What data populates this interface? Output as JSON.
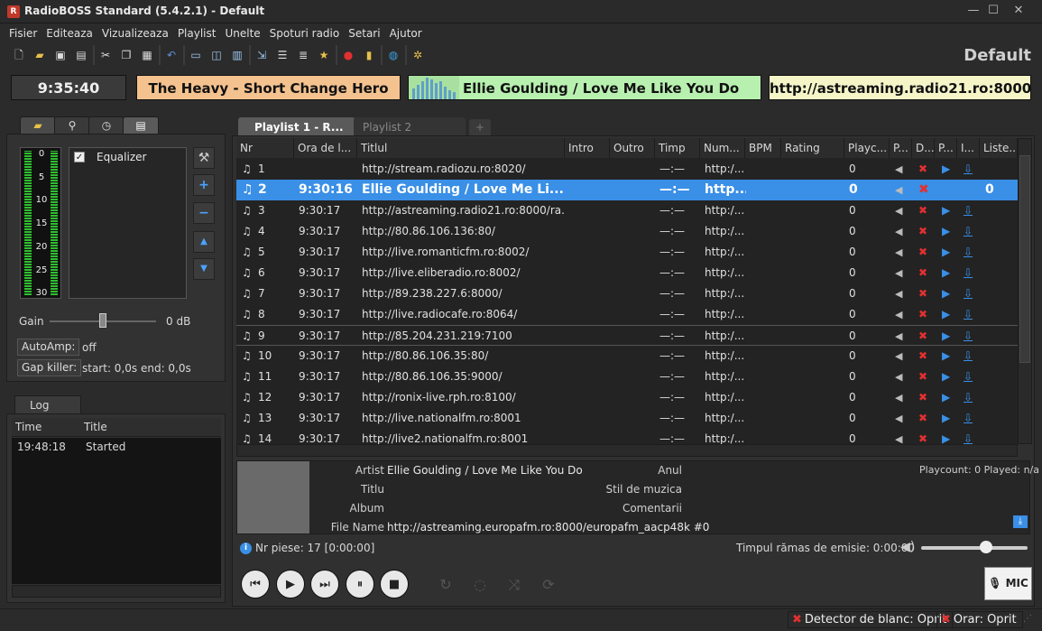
{
  "window": {
    "title": "RadioBOSS Standard (5.4.2.1) - Default",
    "min_label": "—",
    "max_label": "☐",
    "close_label": "✕"
  },
  "menu": [
    "Fisier",
    "Editeaza",
    "Vizualizeaza",
    "Playlist",
    "Unelte",
    "Spoturi radio",
    "Setari",
    "Ajutor"
  ],
  "profile_name": "Default",
  "infobar": {
    "clock": "9:35:40",
    "previous": "The Heavy - Short Change Hero",
    "current": "Ellie Goulding / Love Me Like You Do",
    "stream_url": "http://astreaming.radio21.ro:8000"
  },
  "equalizer": {
    "vu_labels": [
      "0",
      "5",
      "10",
      "15",
      "20",
      "25",
      "30"
    ],
    "checkbox_label": "Equalizer",
    "gain_label": "Gain",
    "gain_value": "0 dB",
    "gain_level": 0.5,
    "autoamp_label": "AutoAmp:",
    "autoamp_value": "off",
    "gapkiller_label": "Gap killer:",
    "gapkiller_value": "start: 0,0s end: 0,0s"
  },
  "log": {
    "tab": "Log",
    "columns": [
      "Time",
      "Title"
    ],
    "rows": [
      {
        "time": "19:48:18",
        "title": "Started"
      }
    ]
  },
  "playlist": {
    "tabs": [
      "Playlist 1 - R...",
      "Playlist 2"
    ],
    "add_tab": "+",
    "columns": [
      "Nr",
      "Ora de l...",
      "Titlul",
      "Intro",
      "Outro",
      "Timp",
      "Num...",
      "BPM",
      "Rating",
      "Playc...",
      "P...",
      "D...",
      "P...",
      "I...",
      "Liste..."
    ],
    "rows": [
      {
        "nr": "1",
        "time": "",
        "title": "http://stream.radiozu.ro:8020/",
        "timp": "—:—",
        "num": "http:/...",
        "playc": "0",
        "listeners": ""
      },
      {
        "nr": "2",
        "time": "9:30:16",
        "title": "Ellie Goulding / Love Me Li...",
        "timp": "—:—",
        "num": "http...",
        "playc": "0",
        "listeners": "0"
      },
      {
        "nr": "3",
        "time": "9:30:17",
        "title": "http://astreaming.radio21.ro:8000/ra...",
        "timp": "—:—",
        "num": "http:/...",
        "playc": "0",
        "listeners": ""
      },
      {
        "nr": "4",
        "time": "9:30:17",
        "title": "http://80.86.106.136:80/",
        "timp": "—:—",
        "num": "http:/...",
        "playc": "0",
        "listeners": ""
      },
      {
        "nr": "5",
        "time": "9:30:17",
        "title": "http://live.romanticfm.ro:8002/",
        "timp": "—:—",
        "num": "http:/...",
        "playc": "0",
        "listeners": ""
      },
      {
        "nr": "6",
        "time": "9:30:17",
        "title": "http://live.eliberadio.ro:8002/",
        "timp": "—:—",
        "num": "http:/...",
        "playc": "0",
        "listeners": ""
      },
      {
        "nr": "7",
        "time": "9:30:17",
        "title": "http://89.238.227.6:8000/",
        "timp": "—:—",
        "num": "http:/...",
        "playc": "0",
        "listeners": ""
      },
      {
        "nr": "8",
        "time": "9:30:17",
        "title": "http://live.radiocafe.ro:8064/",
        "timp": "—:—",
        "num": "http:/...",
        "playc": "0",
        "listeners": ""
      },
      {
        "nr": "9",
        "time": "9:30:17",
        "title": "http://85.204.231.219:7100",
        "timp": "—:—",
        "num": "http:/...",
        "playc": "0",
        "listeners": ""
      },
      {
        "nr": "10",
        "time": "9:30:17",
        "title": "http://80.86.106.35:80/",
        "timp": "—:—",
        "num": "http:/...",
        "playc": "0",
        "listeners": ""
      },
      {
        "nr": "11",
        "time": "9:30:17",
        "title": "http://80.86.106.35:9000/",
        "timp": "—:—",
        "num": "http:/...",
        "playc": "0",
        "listeners": ""
      },
      {
        "nr": "12",
        "time": "9:30:17",
        "title": "http://ronix-live.rph.ro:8100/",
        "timp": "—:—",
        "num": "http:/...",
        "playc": "0",
        "listeners": ""
      },
      {
        "nr": "13",
        "time": "9:30:17",
        "title": "http://live.nationalfm.ro:8001",
        "timp": "—:—",
        "num": "http:/...",
        "playc": "0",
        "listeners": ""
      },
      {
        "nr": "14",
        "time": "9:30:17",
        "title": "http://live2.nationalfm.ro:8001",
        "timp": "—:—",
        "num": "http:/...",
        "playc": "0",
        "listeners": ""
      }
    ]
  },
  "track_info": {
    "artist_label": "Artist",
    "artist": "Ellie Goulding / Love Me Like You Do",
    "title_label": "Titlu",
    "album_label": "Album",
    "filename_label": "File Name",
    "filename": "http://astreaming.europafm.ro:8000/europafm_aacp48k #0",
    "year_label": "Anul",
    "genre_label": "Stil de muzica",
    "comments_label": "Comentarii",
    "playcount": "Playcount: 0  Played: n/a"
  },
  "status": {
    "track_count": "Nr piese: 17 [0:00:00]",
    "remaining": "Timpul rămas de emisie: 0:00:00",
    "volume_level": 0.6
  },
  "mic_label": "MIC",
  "bottom": {
    "blank_detector": "Detector de blanc: Oprit",
    "schedule_prefix": "",
    "schedule": "Orar: Oprit"
  },
  "colors": {
    "selected_row": "#3a8fe6",
    "prev_track_bg": "#f4c28f",
    "current_track_bg": "#b8f0b0",
    "url_bg": "#f5f5c8",
    "vu_green": "#2fbf2f"
  }
}
